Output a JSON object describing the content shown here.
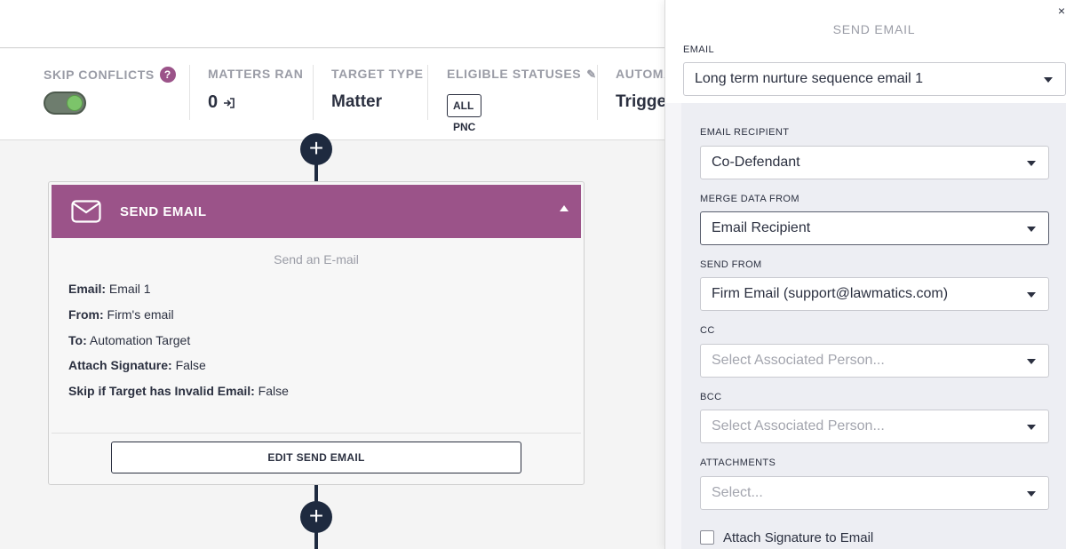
{
  "stats": {
    "skip_conflicts": {
      "label": "SKIP CONFLICTS",
      "help": "?"
    },
    "matters_ran": {
      "label": "MATTERS RAN",
      "value": "0"
    },
    "target_type": {
      "label": "TARGET TYPE",
      "value": "Matter"
    },
    "eligible_statuses": {
      "label": "ELIGIBLE STATUSES",
      "pill": "ALL PNC"
    },
    "automation": {
      "label": "AUTOMA",
      "value": "Trigge"
    }
  },
  "card": {
    "title": "SEND EMAIL",
    "subtitle": "Send an E-mail",
    "details": [
      {
        "key": "Email:",
        "value": " Email 1"
      },
      {
        "key": "From:",
        "value": " Firm's email"
      },
      {
        "key": "To:",
        "value": " Automation Target"
      },
      {
        "key": "Attach Signature:",
        "value": " False"
      },
      {
        "key": "Skip if Target has Invalid Email:",
        "value": " False"
      }
    ],
    "edit_button": "EDIT SEND EMAIL"
  },
  "panel": {
    "title": "SEND EMAIL",
    "close": "×",
    "email": {
      "label": "EMAIL",
      "value": "Long term nurture sequence email 1"
    },
    "recipient": {
      "label": "EMAIL RECIPIENT",
      "value": "Co-Defendant"
    },
    "merge": {
      "label": "MERGE DATA FROM",
      "value": "Email Recipient"
    },
    "send_from": {
      "label": "SEND FROM",
      "value": "Firm Email (support@lawmatics.com)"
    },
    "cc": {
      "label": "CC",
      "placeholder": "Select Associated Person..."
    },
    "bcc": {
      "label": "BCC",
      "placeholder": "Select Associated Person..."
    },
    "attachments": {
      "label": "ATTACHMENTS",
      "placeholder": "Select..."
    },
    "attach_signature": {
      "label": "Attach Signature to Email",
      "checked": false
    }
  },
  "colors": {
    "accent": "#9b5389",
    "navy": "#1e2a3f",
    "toggle_on": "#7cc46a"
  }
}
